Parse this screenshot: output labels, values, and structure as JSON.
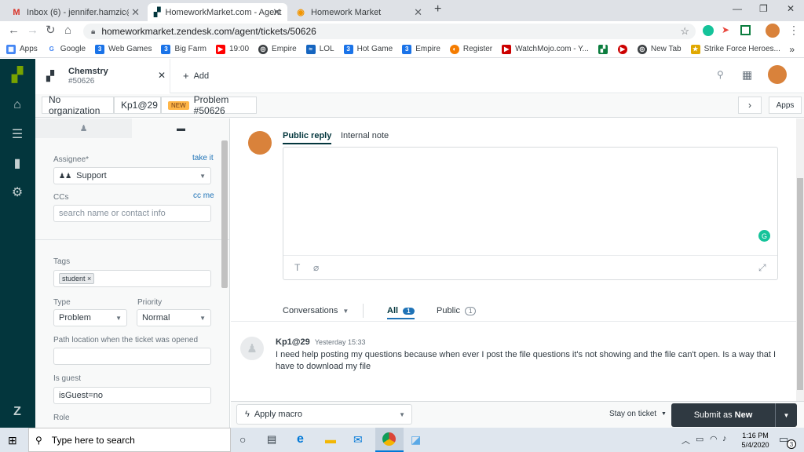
{
  "browser": {
    "tabs": [
      {
        "title": "Inbox (6) - jennifer.hamzic@gma",
        "icon": "gmail-icon"
      },
      {
        "title": "HomeworkMarket.com - Agent",
        "icon": "zendesk-icon"
      },
      {
        "title": "Homework Market",
        "icon": "homework-market-icon"
      }
    ],
    "new_tab": "+",
    "url": "homeworkmarket.zendesk.com/agent/tickets/50626",
    "bookmarks": [
      {
        "label": "Apps",
        "color": "#4285f4"
      },
      {
        "label": "Google",
        "color": "#4285f4"
      },
      {
        "label": "Web Games",
        "color": "#1a73e8"
      },
      {
        "label": "Big Farm",
        "color": "#1a73e8"
      },
      {
        "label": "19:00",
        "color": "#ff0000"
      },
      {
        "label": "Empire",
        "color": "#3c4043"
      },
      {
        "label": "LOL",
        "color": "#1565c0"
      },
      {
        "label": "Hot Game",
        "color": "#1a73e8"
      },
      {
        "label": "Empire",
        "color": "#1a73e8"
      },
      {
        "label": "Register",
        "color": "#f57c00"
      },
      {
        "label": "WatchMojo.com - Y...",
        "color": "#cc0000"
      },
      {
        "label": "",
        "color": "#0b7d3e"
      },
      {
        "label": "",
        "color": "#cc0000"
      },
      {
        "label": "New Tab",
        "color": "#3c4043"
      },
      {
        "label": "Strike Force Heroes...",
        "color": "#e0a800"
      }
    ]
  },
  "zendesk": {
    "ticket_tab": {
      "title": "Chemstry",
      "number": "#50626"
    },
    "add_label": "Add",
    "apps_label": "Apps",
    "breadcrumbs": {
      "organization": "No organization",
      "requester": "Kp1@29",
      "badge": "NEW",
      "ticket": "Problem #50626"
    },
    "left": {
      "assignee_label": "Assignee*",
      "take_it": "take it",
      "assignee_value": "Support",
      "ccs_label": "CCs",
      "cc_me": "cc me",
      "cc_placeholder": "search name or contact info",
      "tags_label": "Tags",
      "tag": "student",
      "type_label": "Type",
      "type_value": "Problem",
      "priority_label": "Priority",
      "priority_value": "Normal",
      "path_label": "Path location when the ticket was opened",
      "path_value": "",
      "guest_label": "Is guest",
      "guest_value": "isGuest=no",
      "role_label": "Role"
    },
    "reply": {
      "public_reply": "Public reply",
      "internal_note": "Internal note"
    },
    "filters": {
      "conversations": "Conversations",
      "all": "All",
      "all_count": "1",
      "public": "Public",
      "public_count": "1"
    },
    "comment": {
      "author": "Kp1@29",
      "time": "Yesterday 15:33",
      "body": "I need help posting my questions because when ever I post the file questions it's not showing and the file can't open. Is a way that I have to download my file"
    },
    "footer": {
      "macro": "Apply macro",
      "stay": "Stay on ticket",
      "submit_prefix": "Submit as ",
      "submit_status": "New"
    }
  },
  "taskbar": {
    "search_placeholder": "Type here to search",
    "time": "1:16 PM",
    "date": "5/4/2020",
    "notifications": "3"
  },
  "colors": {
    "zendesk_nav": "#03363d",
    "submit": "#2f3941",
    "badge": "#ffb648",
    "grammarly": "#15c39a"
  }
}
